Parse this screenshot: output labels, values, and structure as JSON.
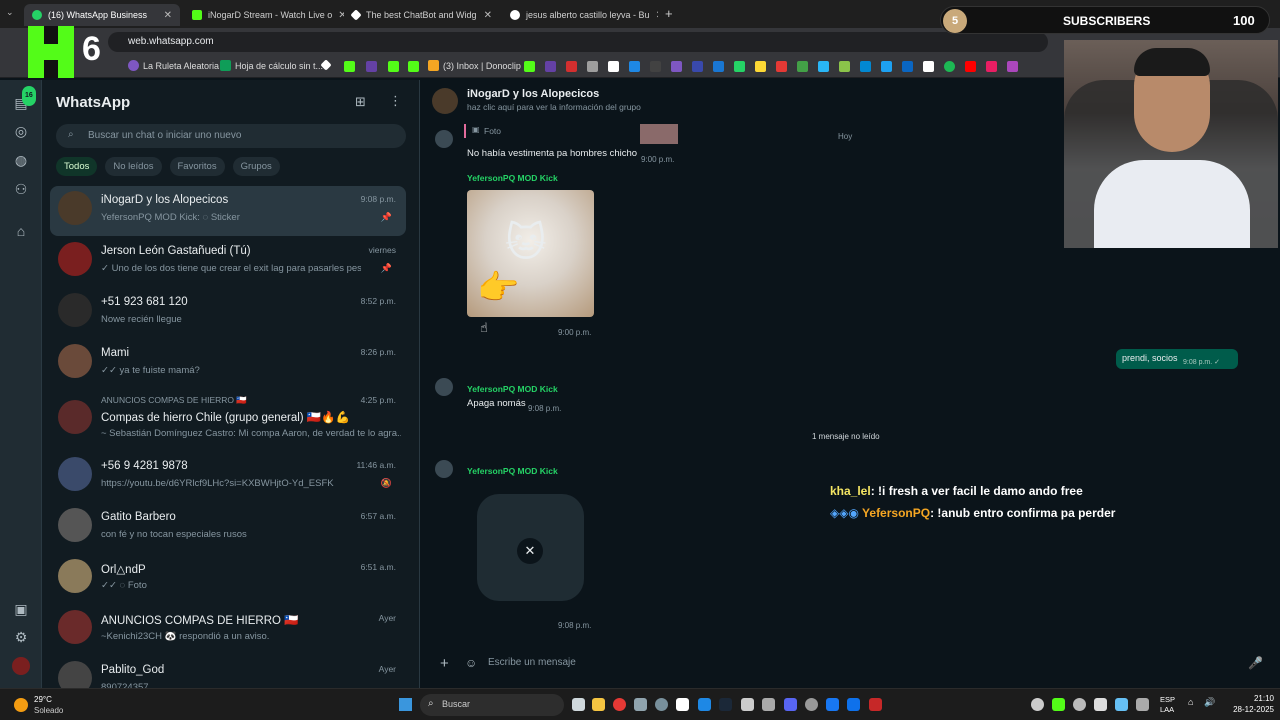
{
  "browser": {
    "tabs": [
      {
        "label": "(16) WhatsApp Business",
        "active": true
      },
      {
        "label": "iNogarD Stream - Watch Live o"
      },
      {
        "label": "The best ChatBot and Widg"
      },
      {
        "label": "jesus alberto castillo leyva - Bu"
      }
    ],
    "url": "web.whatsapp.com",
    "bookmarks": [
      "La Ruleta Aleatoria",
      "Hoja de cálculo sin t...",
      "(3) Inbox | Donoclip"
    ]
  },
  "overlay": {
    "logo_number": "6",
    "subscribers_label": "SUBSCRIBERS",
    "subscribers_count": "100",
    "subscribers_badge": "5",
    "chat_line1_user": "kha_lel",
    "chat_line1_text": ": !i fresh a ver facil le damo ando free",
    "chat_line2_user": "YefersonPQ",
    "chat_line2_text": ": !anub entro confirma pa perder"
  },
  "app": {
    "title": "WhatsApp",
    "badge": "16",
    "search_placeholder": "Buscar un chat o iniciar uno nuevo",
    "filters": [
      "Todos",
      "No leídos",
      "Favoritos",
      "Grupos"
    ]
  },
  "chats": [
    {
      "name": "iNogarD y los Alopecicos",
      "preview": "YefersonPQ MOD Kick: ◌ Sticker",
      "time": "9:08 p.m.",
      "pin": "📌",
      "avatar": "#4a3a2a"
    },
    {
      "name": "Jerson León Gastañuedi (Tú)",
      "preview": "✓ Uno de los dos tiene que crear el exit lag para pasarles pes",
      "time": "viernes",
      "pin": "📌",
      "avatar": "#7a1f1f"
    },
    {
      "name": "+51 923 681 120",
      "preview": "Nowe recién llegue",
      "time": "8:52 p.m.",
      "avatar": "#2a2a2a"
    },
    {
      "name": "Mami",
      "preview": "✓✓ ya te fuiste mamá?",
      "time": "8:26 p.m.",
      "avatar": "#6a4a3a"
    },
    {
      "name": "Compas de hierro Chile (grupo general) 🇨🇱🔥💪",
      "header": "ANUNCIOS COMPAS DE HIERRO 🇨🇱",
      "preview": "~ Sebastián Domínguez Castro: Mi compa Aaron, de verdad te lo agra...",
      "time": "4:25 p.m.",
      "avatar": "#5a2a2a"
    },
    {
      "name": "+56 9 4281 9878",
      "preview": "https://youtu.be/d6YRlcf9LHc?si=KXBWHjtO-Yd_ESFK",
      "time": "11:46 a.m.",
      "avatar": "#3a4a6a"
    },
    {
      "name": "Gatito Barbero",
      "preview": "con fé y no tocan especiales rusos",
      "time": "6:57 a.m.",
      "avatar": "#555555"
    },
    {
      "name": "Orl△ndP",
      "preview": "✓✓ ◌ Foto",
      "time": "6:51 a.m.",
      "avatar": "#8a7a5a"
    },
    {
      "name": "ANUNCIOS COMPAS DE HIERRO 🇨🇱",
      "preview": "~Kenichi23CH 🐼 respondió a un aviso.",
      "time": "Ayer",
      "avatar": "#6a2a2a"
    },
    {
      "name": "Pablito_God",
      "preview": "890724357",
      "time": "Ayer",
      "avatar": "#444444"
    }
  ],
  "conversation": {
    "group_name": "iNogarD y los Alopecicos",
    "group_sub": "haz clic aquí para ver la información del grupo",
    "quoted_label": "Foto",
    "msg1_text": "No había vestimenta pa hombres chicho",
    "msg1_time": "9:00 p.m.",
    "date_chip": "Hoy",
    "sender1": "YefersonPQ MOD Kick",
    "sticker_time": "9:00 p.m.",
    "out_text": "prendi, socios",
    "out_time": "9:08 p.m. ✓",
    "sender2": "YefersonPQ MOD Kick",
    "msg2_text": "Apaga nomás",
    "msg2_time": "9:08 p.m.",
    "unread_chip": "1 mensaje no leído",
    "sender3": "YefersonPQ MOD Kick",
    "loading_time": "9:08 p.m.",
    "compose_placeholder": "Escribe un mensaje"
  },
  "taskbar": {
    "weather_temp": "29°C",
    "weather_desc": "Soleado",
    "search_label": "Buscar",
    "lang1": "ESP",
    "lang2": "LAA",
    "time": "21:10",
    "date": "28-12-2025"
  }
}
